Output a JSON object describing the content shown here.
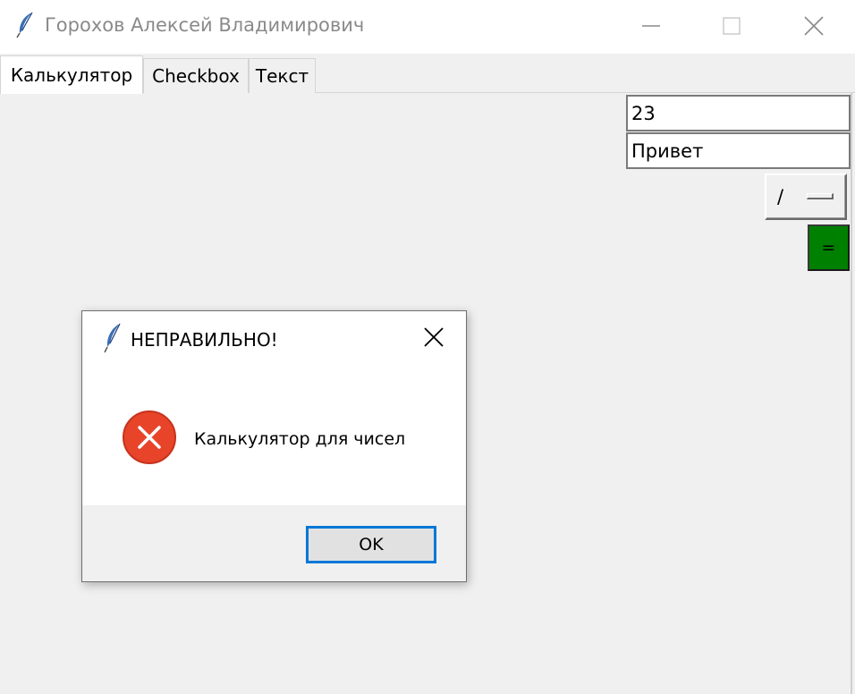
{
  "window": {
    "title": "Горохов Алексей Владимирович"
  },
  "tabs": [
    {
      "label": "Калькулятор",
      "active": true
    },
    {
      "label": "Checkbox",
      "active": false
    },
    {
      "label": "Текст",
      "active": false
    }
  ],
  "calculator": {
    "entry1_value": "23",
    "entry2_value": "Привет",
    "operation_selected": "/",
    "equals_label": "=",
    "equals_color": "#008000"
  },
  "dialog": {
    "title": "НЕПРАВИЛЬНО!",
    "message": "Калькулятор для чисел",
    "ok_label": "OK",
    "icon": "error-icon",
    "error_color": "#e8442a",
    "focus_color": "#0078d7"
  }
}
